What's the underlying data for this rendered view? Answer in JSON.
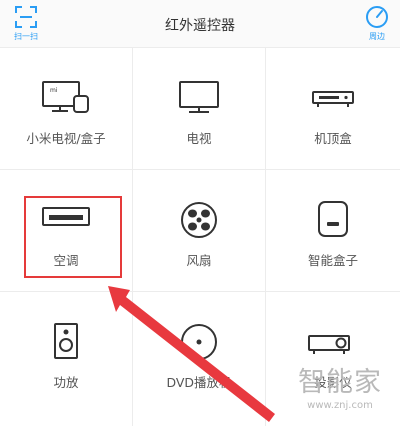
{
  "header": {
    "title": "红外遥控器",
    "scan_label": "扫一扫",
    "nearby_label": "周边"
  },
  "devices": [
    {
      "label": "小米电视/盒子",
      "icon": "mi-tv-box-icon"
    },
    {
      "label": "电视",
      "icon": "tv-icon"
    },
    {
      "label": "机顶盒",
      "icon": "set-top-box-icon"
    },
    {
      "label": "空调",
      "icon": "air-conditioner-icon"
    },
    {
      "label": "风扇",
      "icon": "fan-icon"
    },
    {
      "label": "智能盒子",
      "icon": "smart-box-icon"
    },
    {
      "label": "功放",
      "icon": "amplifier-icon"
    },
    {
      "label": "DVD播放机",
      "icon": "dvd-player-icon"
    },
    {
      "label": "投影仪",
      "icon": "projector-icon"
    }
  ],
  "watermark": {
    "logo": "智能家",
    "url": "www.znj.com"
  },
  "colors": {
    "accent": "#2a9df4",
    "highlight": "#e53a3a",
    "icon": "#333333"
  }
}
